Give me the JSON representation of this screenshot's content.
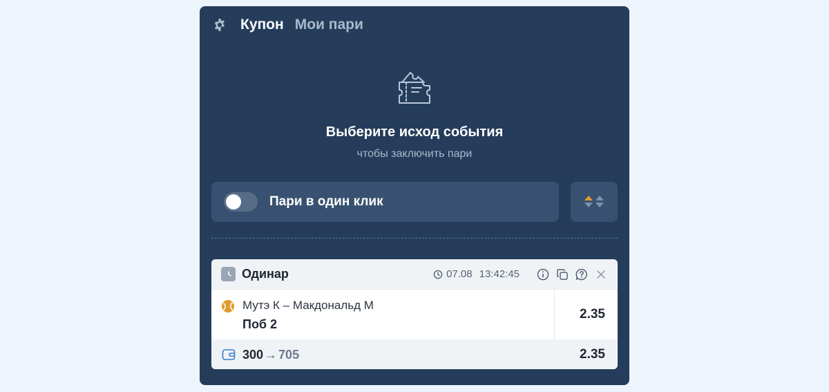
{
  "header": {
    "tabs": [
      {
        "label": "Купон",
        "active": true
      },
      {
        "label": "Мои пари",
        "active": false
      }
    ]
  },
  "empty_state": {
    "title": "Выберите исход события",
    "subtitle": "чтобы заключить пари"
  },
  "one_click": {
    "label": "Пари в один клик",
    "enabled": false
  },
  "coupon": {
    "type": "Одинар",
    "date": "07.08",
    "time": "13:42:45",
    "event": {
      "match": "Мутэ К – Макдональд М",
      "outcome": "Поб 2",
      "odds": "2.35"
    },
    "stake": "300",
    "arrow": "→",
    "payout": "705",
    "total_odds": "2.35"
  },
  "colors": {
    "panel_bg": "#253d5b",
    "accent_orange": "#e39a2c",
    "page_bg": "#eef4fc"
  },
  "icons": [
    "gear-icon",
    "ticket-icon",
    "sort-arrows-icon",
    "clock-icon",
    "info-icon",
    "copy-icon",
    "help-icon",
    "close-icon",
    "tennis-ball-icon",
    "wallet-icon"
  ]
}
